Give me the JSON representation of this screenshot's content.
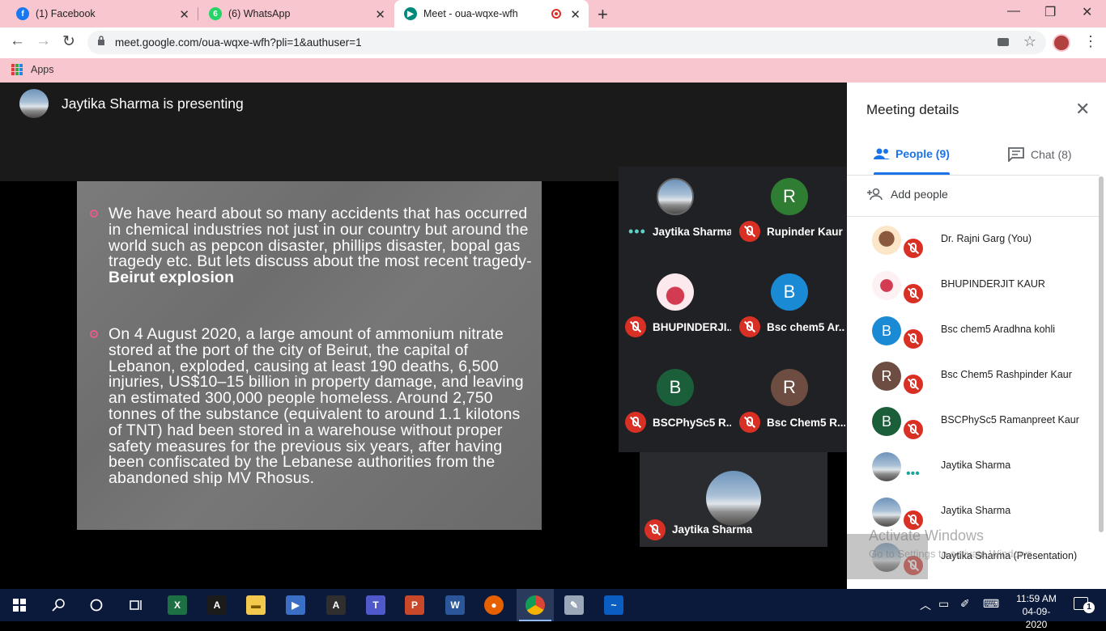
{
  "browser": {
    "tabs": [
      {
        "label": "(1) Facebook",
        "icon": "facebook-icon",
        "color": "#1877f2"
      },
      {
        "label": "(6) WhatsApp",
        "icon": "whatsapp-icon",
        "color": "#25d366"
      },
      {
        "label": "Meet - oua-wqxe-wfh",
        "icon": "meet-icon",
        "color": "#00897b"
      }
    ],
    "url": "meet.google.com/oua-wqxe-wfh?pli=1&authuser=1",
    "bookmarks_apps": "Apps"
  },
  "meet": {
    "presenting_banner": "Jaytika Sharma is presenting",
    "slide": {
      "para1_text": "We have heard about so many accidents that has occurred in chemical industries not just in our country but around the world such as pepcon disaster, phillips disaster, bopal gas tragedy etc. But lets discuss about the most recent tragedy- ",
      "para1_bold": "Beirut explosion",
      "para2_text": "On 4 August 2020, a large amount of ammonium nitrate stored at the port of the city of Beirut, the capital of Lebanon, exploded, causing at least 190 deaths, 6,500 injuries, US$10–15 billion in property damage, and leaving an estimated 300,000 people homeless. Around 2,750 tonnes of the substance (equivalent to around 1.1 kilotons of TNT) had been stored in a warehouse without proper safety measures for the previous six years, after having been confiscated by the Lebanese authorities from the abandoned ship MV Rhosus."
    },
    "tiles": [
      {
        "name": "Jaytika Sharma",
        "initial": "",
        "color": "",
        "status": "speaking"
      },
      {
        "name": "Rupinder Kaur",
        "initial": "R",
        "color": "#2e7d32",
        "status": "muted"
      },
      {
        "name": "BHUPINDERJI...",
        "initial": "",
        "color": "",
        "status": "muted"
      },
      {
        "name": "Bsc chem5 Ar...",
        "initial": "B",
        "color": "#1a8ad4",
        "status": "muted"
      },
      {
        "name": "BSCPhySc5 R...",
        "initial": "B",
        "color": "#1b5e3a",
        "status": "muted"
      },
      {
        "name": "Bsc Chem5 R...",
        "initial": "R",
        "color": "#6d4c41",
        "status": "muted"
      }
    ],
    "self_tile_name": "Jaytika Sharma"
  },
  "panel": {
    "title": "Meeting details",
    "tab_people": "People (9)",
    "tab_chat": "Chat (8)",
    "add_people": "Add people",
    "people": [
      {
        "name": "Dr. Rajni Garg (You)",
        "initial": "",
        "color": "#f6d7b8",
        "status": "muted"
      },
      {
        "name": "BHUPINDERJIT KAUR",
        "initial": "",
        "color": "#f3d6dc",
        "status": "muted"
      },
      {
        "name": "Bsc chem5 Aradhna kohli",
        "initial": "B",
        "color": "#1a8ad4",
        "status": "muted"
      },
      {
        "name": "Bsc Chem5 Rashpinder Kaur",
        "initial": "R",
        "color": "#6d4c41",
        "status": "muted"
      },
      {
        "name": "BSCPhySc5 Ramanpreet Kaur",
        "initial": "B",
        "color": "#1b5e3a",
        "status": "muted"
      },
      {
        "name": "Jaytika Sharma",
        "initial": "",
        "color": "",
        "status": "speaking"
      },
      {
        "name": "Jaytika Sharma",
        "initial": "",
        "color": "",
        "status": "muted"
      },
      {
        "name": "Jaytika Sharma (Presentation)",
        "initial": "",
        "color": "",
        "status": "muted"
      }
    ]
  },
  "watermark": {
    "line1": "Activate Windows",
    "line2": "Go to Settings to activate Windows."
  },
  "taskbar": {
    "time": "11:59 AM",
    "date": "04-09-2020",
    "notifications": "1"
  }
}
